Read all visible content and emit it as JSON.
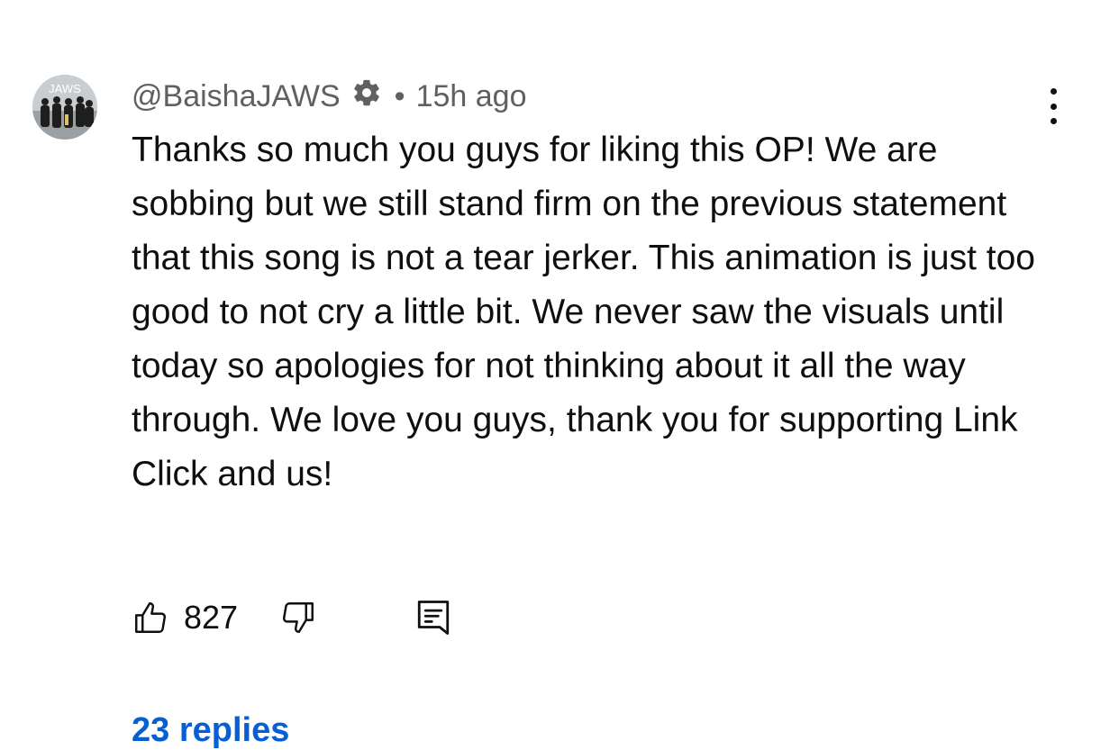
{
  "comment": {
    "handle": "@BaishaJAWS",
    "separator": "•",
    "timestamp": "15h ago",
    "avatar_text": "JAWS",
    "text": "Thanks so much you guys for liking this OP! We are sobbing but we still stand firm on the previous statement that this song is not a tear jerker. This animation is just too good to not cry a little bit. We never saw the visuals until today so apologies for not thinking about it all the way through. We love you guys, thank you for supporting Link Click and us!",
    "like_count": "827",
    "replies_label": "23 replies"
  },
  "icons": {
    "creator_badge": "gear-badge-icon",
    "menu": "more-vertical-icon",
    "like": "thumbs-up-icon",
    "dislike": "thumbs-down-icon",
    "reply": "comment-reply-icon"
  },
  "colors": {
    "text": "#0f0f0f",
    "secondary_text": "#606060",
    "link": "#065fd4"
  }
}
